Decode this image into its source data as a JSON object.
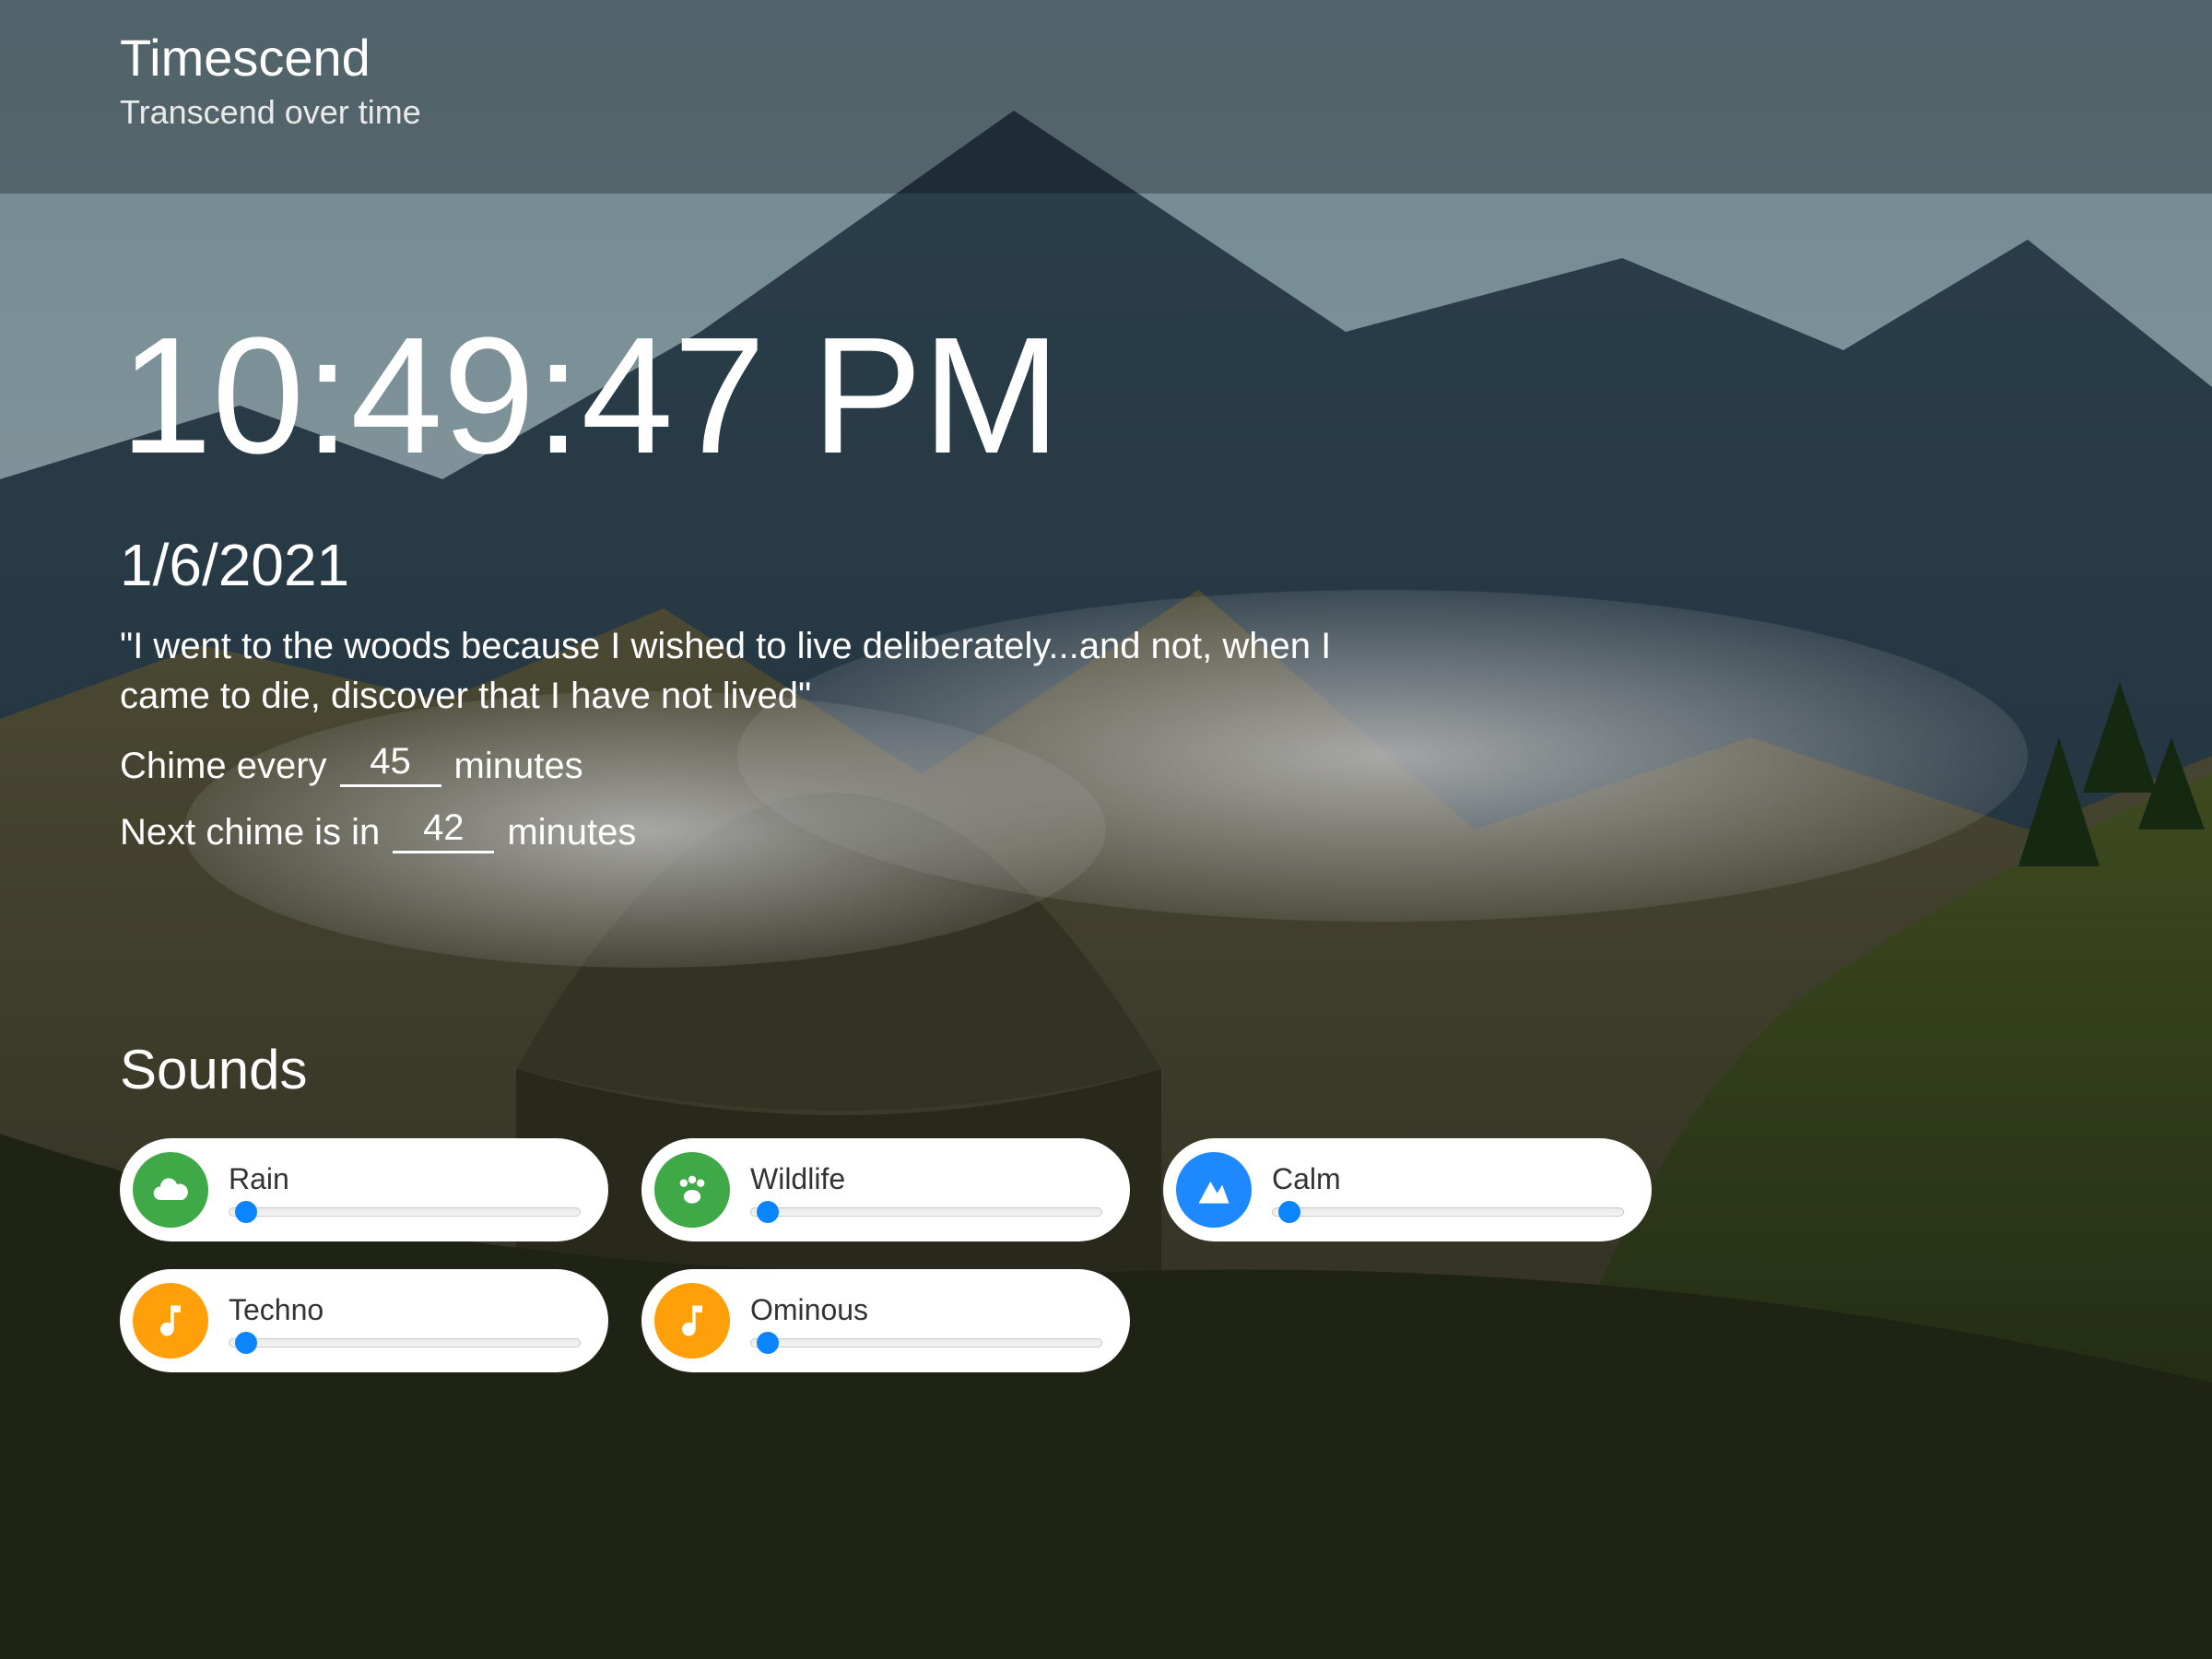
{
  "header": {
    "title": "Timescend",
    "subtitle": "Transcend over time"
  },
  "clock": {
    "time": "10:49:47 PM",
    "date": "1/6/2021"
  },
  "quote": "\"I went to the woods because I wished to live deliberately...and not, when I came to die, discover that I have not lived\"",
  "chime": {
    "every_prefix": "Chime every",
    "every_value": "45",
    "every_suffix": "minutes",
    "next_prefix": "Next chime is in",
    "next_value": "42",
    "next_suffix": "minutes"
  },
  "sounds": {
    "heading": "Sounds",
    "items": [
      {
        "name": "Rain",
        "icon": "cloud-icon",
        "color": "ic-green",
        "value": 5
      },
      {
        "name": "Wildlife",
        "icon": "paw-icon",
        "color": "ic-green",
        "value": 5
      },
      {
        "name": "Calm",
        "icon": "mountain-icon",
        "color": "ic-blue",
        "value": 5
      },
      {
        "name": "Techno",
        "icon": "music-icon",
        "color": "ic-orange",
        "value": 5
      },
      {
        "name": "Ominous",
        "icon": "music-icon",
        "color": "ic-orange",
        "value": 5
      }
    ]
  }
}
